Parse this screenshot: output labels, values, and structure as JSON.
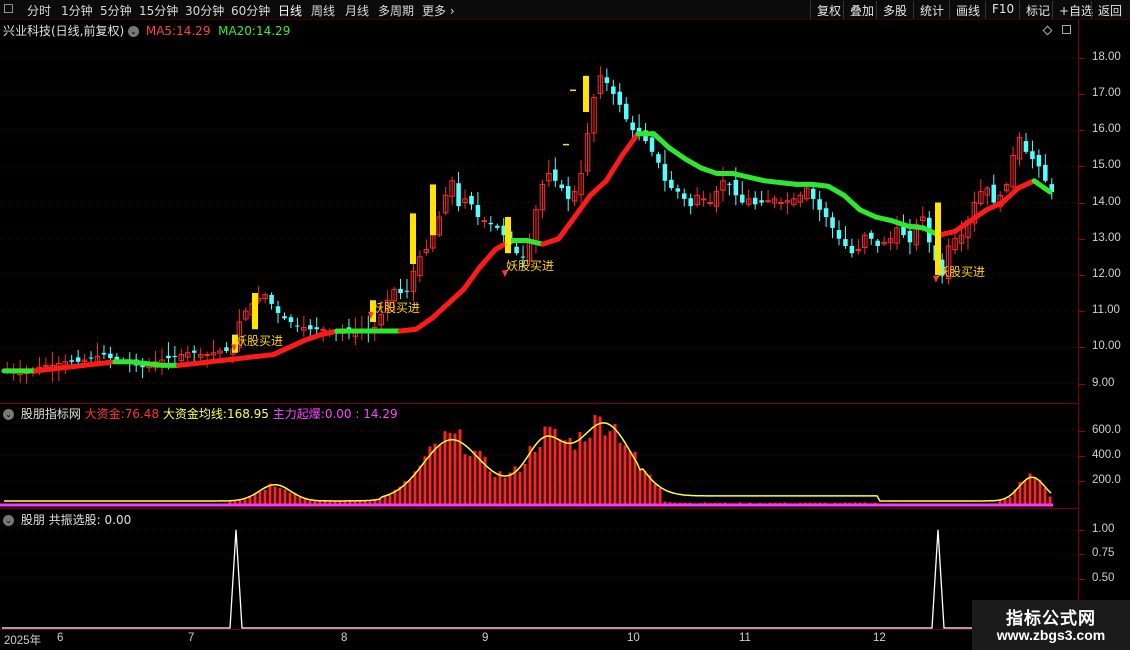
{
  "toolbar": {
    "periods": [
      "分时",
      "1分钟",
      "5分钟",
      "15分钟",
      "30分钟",
      "60分钟",
      "日线",
      "周线",
      "月线",
      "多周期",
      "更多"
    ],
    "active_period": "日线",
    "right_buttons": [
      "复权",
      "叠加",
      "多股",
      "统计",
      "画线",
      "F10",
      "标记",
      "+自选",
      "返回"
    ]
  },
  "main_panel": {
    "stock_title": "兴业科技(日线,前复权)",
    "ma5_label": "MA5:",
    "ma5_value": "14.29",
    "ma20_label": "MA20:",
    "ma20_value": "14.29",
    "y_ticks": [
      "18.00",
      "17.00",
      "16.00",
      "15.00",
      "14.00",
      "13.00",
      "12.00",
      "11.00",
      "10.00",
      "9.00"
    ],
    "buy_signal_text": "妖股买进",
    "colors": {
      "up": "#ff2a2a",
      "down": "#54ffff",
      "ma_up": "#ff1a1a",
      "ma_down": "#2ee82e",
      "signal_bar": "#ffe400",
      "signal_text": "#ffd400"
    }
  },
  "indicator_panel": {
    "name": "股朋指标网",
    "big_money_label": "大资金:",
    "big_money_value": "76.48",
    "big_money_avg_label": "大资金均线:",
    "big_money_avg_value": "168.95",
    "main_force_label": "主力起爆:",
    "main_force_value": "0.00",
    "extra_value": ": 14.29",
    "y_ticks": [
      "600.0",
      "400.0",
      "200.0"
    ],
    "colors": {
      "bars": "#ff2222",
      "avg": "#ffff33",
      "main_force": "#ff33ff"
    }
  },
  "signal_panel": {
    "name": "股朋",
    "label": "共振选股:",
    "value": "0.00",
    "y_ticks": [
      "1.00",
      "0.75",
      "0.50"
    ]
  },
  "x_axis": {
    "labels": [
      "2025年",
      "6",
      "7",
      "8",
      "9",
      "10",
      "11",
      "12"
    ]
  },
  "watermark": {
    "line1": "指标公式网",
    "line2": "www.zbgs3.com"
  },
  "chart_data": [
    {
      "type": "candlestick",
      "title": "兴业科技(日线,前复权)",
      "ylim": [
        8.6,
        18.6
      ],
      "series": [
        {
          "name": "MA5",
          "last": 14.29
        },
        {
          "name": "MA20",
          "last": 14.29
        }
      ],
      "approx_close": [
        9.35,
        9.35,
        9.3,
        9.35,
        9.4,
        9.45,
        9.5,
        9.5,
        9.55,
        9.6,
        9.6,
        9.6,
        9.65,
        9.7,
        9.75,
        9.8,
        9.7,
        9.65,
        9.6,
        9.55,
        9.5,
        9.45,
        9.5,
        9.6,
        9.65,
        9.7,
        9.75,
        9.8,
        9.85,
        9.85,
        9.8,
        9.8,
        9.85,
        9.9,
        9.9,
        9.95,
        10.7,
        11.0,
        11.2,
        11.35,
        11.45,
        11.2,
        10.95,
        10.8,
        10.7,
        10.6,
        10.55,
        10.5,
        10.5,
        10.5,
        10.45,
        10.4,
        10.45,
        10.4,
        10.45,
        10.5,
        10.45,
        10.55,
        10.9,
        11.3,
        11.6,
        11.5,
        11.55,
        12.1,
        12.5,
        12.7,
        13.1,
        13.6,
        14.2,
        14.6,
        13.9,
        14.1,
        13.95,
        13.6,
        13.5,
        13.4,
        13.3,
        13.1,
        12.85,
        12.6,
        12.5,
        12.9,
        13.8,
        14.5,
        14.8,
        14.6,
        14.4,
        14.1,
        14.3,
        14.8,
        15.9,
        16.9,
        17.5,
        17.3,
        17.0,
        16.7,
        16.3,
        16.0,
        15.9,
        15.7,
        15.4,
        15.1,
        14.6,
        14.4,
        14.3,
        14.1,
        13.9,
        14.2,
        14.1,
        14.0,
        14.3,
        14.6,
        14.5,
        14.2,
        14.0,
        14.1,
        13.95,
        14.0,
        14.05,
        14.1,
        14.0,
        14.05,
        14.1,
        14.2,
        14.4,
        14.1,
        13.8,
        13.6,
        13.3,
        13.0,
        12.8,
        12.6,
        12.7,
        13.1,
        13.0,
        12.8,
        12.9,
        13.0,
        13.3,
        13.1,
        12.9,
        13.4,
        13.6,
        12.9,
        12.4,
        12.0,
        12.8,
        13.0,
        13.1,
        13.5,
        14.0,
        14.3,
        14.4,
        14.0,
        14.2,
        14.5,
        15.3,
        15.8,
        15.4,
        15.2,
        15.0,
        14.6,
        14.29
      ],
      "ma20_approx": [
        9.35,
        9.35,
        9.35,
        9.4,
        9.45,
        9.5,
        9.55,
        9.6,
        9.6,
        9.55,
        9.5,
        9.5,
        9.55,
        9.6,
        9.65,
        9.7,
        9.75,
        9.8,
        10.0,
        10.2,
        10.35,
        10.45,
        10.45,
        10.45,
        10.45,
        10.45,
        10.5,
        10.8,
        11.2,
        11.6,
        12.2,
        12.7,
        12.95,
        12.95,
        12.85,
        13.0,
        13.6,
        14.2,
        14.6,
        15.3,
        15.9,
        15.9,
        15.5,
        15.2,
        14.95,
        14.8,
        14.8,
        14.7,
        14.6,
        14.55,
        14.5,
        14.5,
        14.45,
        14.2,
        13.8,
        13.6,
        13.5,
        13.35,
        13.3,
        13.1,
        13.2,
        13.5,
        13.8,
        14.0,
        14.4,
        14.6,
        14.29
      ]
    },
    {
      "type": "bar",
      "title": "股朋指标网",
      "ylim": [
        0,
        700
      ],
      "series": [
        {
          "name": "大资金",
          "last": 76.48
        },
        {
          "name": "大资金均线",
          "last": 168.95
        },
        {
          "name": "主力起爆",
          "last": 0.0
        }
      ],
      "approx_avg_peaks": [
        {
          "x_label": "7",
          "value": 170
        },
        {
          "x_label": "8",
          "value": 450
        },
        {
          "x_label": "9",
          "value": 400
        },
        {
          "x_label": "10",
          "value": 620
        },
        {
          "x_label": "12",
          "value": 230
        }
      ]
    },
    {
      "type": "line",
      "title": "股朋",
      "ylim": [
        0,
        1.1
      ],
      "series": [
        {
          "name": "共振选股",
          "last": 0.0
        }
      ],
      "peaks": [
        {
          "x_label": "7",
          "value": 1.0
        },
        {
          "x_label": "12",
          "value": 1.0
        }
      ]
    }
  ]
}
